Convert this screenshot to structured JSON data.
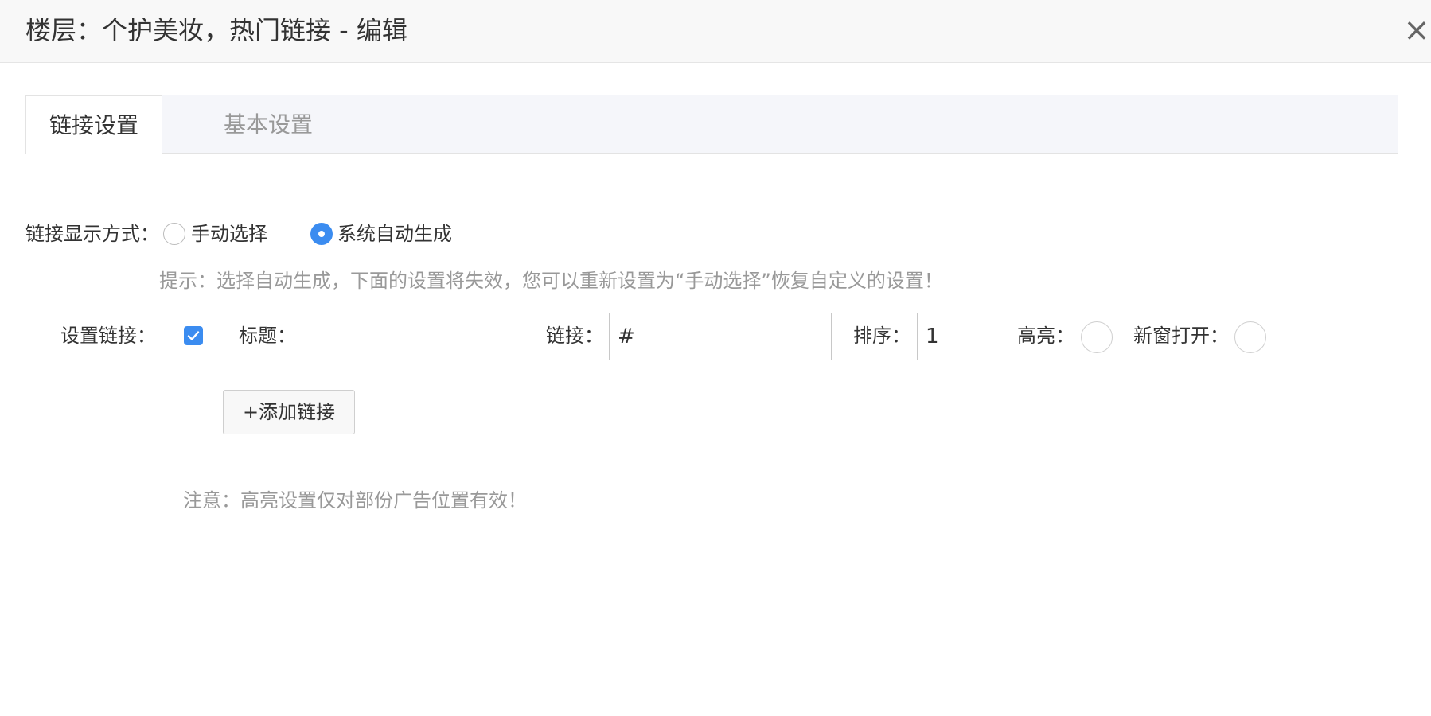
{
  "dialog": {
    "title": "楼层：个护美妆，热门链接 - 编辑",
    "close_glyph": "×"
  },
  "tabs": [
    {
      "label": "链接设置",
      "active": true
    },
    {
      "label": "基本设置",
      "active": false
    }
  ],
  "display_mode": {
    "label": "链接显示方式：",
    "options": [
      {
        "label": "手动选择",
        "selected": false
      },
      {
        "label": "系统自动生成",
        "selected": true
      }
    ]
  },
  "hint": "提示：选择自动生成，下面的设置将失效，您可以重新设置为“手动选择”恢复自定义的设置！",
  "link_row": {
    "label": "设置链接：",
    "checked": true,
    "title_label": "标题：",
    "title_value": "",
    "link_label": "链接：",
    "link_value": "#",
    "sort_label": "排序：",
    "sort_value": "1",
    "highlight_label": "高亮：",
    "new_window_label": "新窗打开："
  },
  "add_button": "+添加链接",
  "note": "注意：高亮设置仅对部份广告位置有效！",
  "colors": {
    "accent": "#3b8cf0",
    "muted_text": "#999999",
    "text": "#333333"
  }
}
